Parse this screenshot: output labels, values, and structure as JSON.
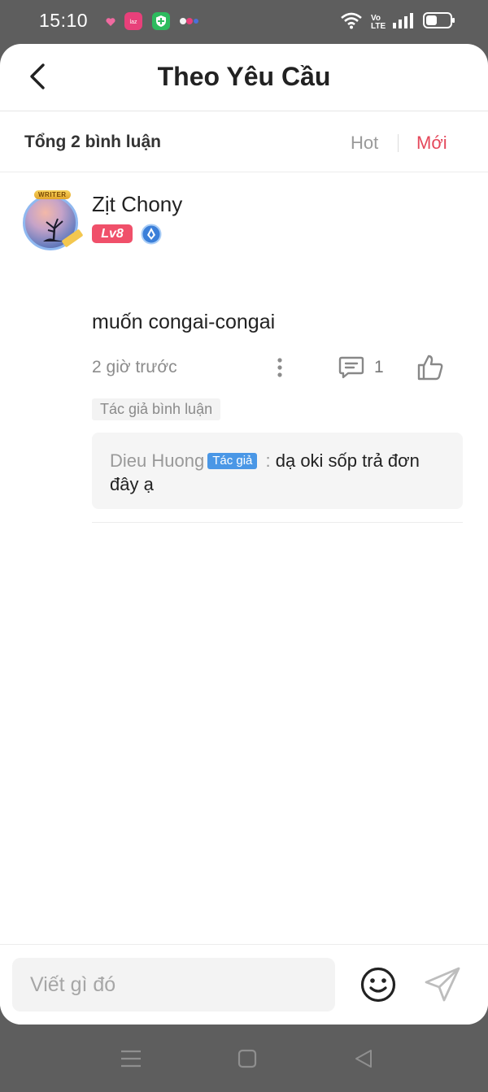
{
  "status_bar": {
    "time": "15:10",
    "notification_icons": [
      "heart-icon",
      "lazada-app-icon",
      "shield-app-icon",
      "dot-app-icon"
    ],
    "system_icons": [
      "wifi-icon",
      "volte-icon",
      "signal-icon",
      "battery-icon"
    ],
    "volte_label": "Vo LTE"
  },
  "header": {
    "title": "Theo Yêu Cầu",
    "back_icon": "chevron-left-icon"
  },
  "subbar": {
    "total": "Tổng 2 bình luận",
    "sort_hot": "Hot",
    "sort_new": "Mới",
    "active_sort": "Mới",
    "active_color": "#e5485b"
  },
  "comment": {
    "username": "Zịt Chony",
    "avatar_badge": "WRITER",
    "level": "Lv8",
    "level_color": "#f0506a",
    "text": "muốn congai-congai",
    "time": "2 giờ trước",
    "reply_count": "1",
    "author_label": "Tác giả bình luận",
    "reply": {
      "author": "Dieu Huong",
      "tag": "Tác giả",
      "separator": " : ",
      "text": "dạ oki sốp trả đơn đây ạ",
      "tag_color": "#4a97e6"
    }
  },
  "input": {
    "placeholder": "Viết gì đó",
    "emoji_icon": "smiley-icon",
    "send_icon": "send-icon"
  },
  "nav_bar": {
    "buttons": [
      "menu-icon",
      "home-square-icon",
      "back-triangle-icon"
    ]
  }
}
